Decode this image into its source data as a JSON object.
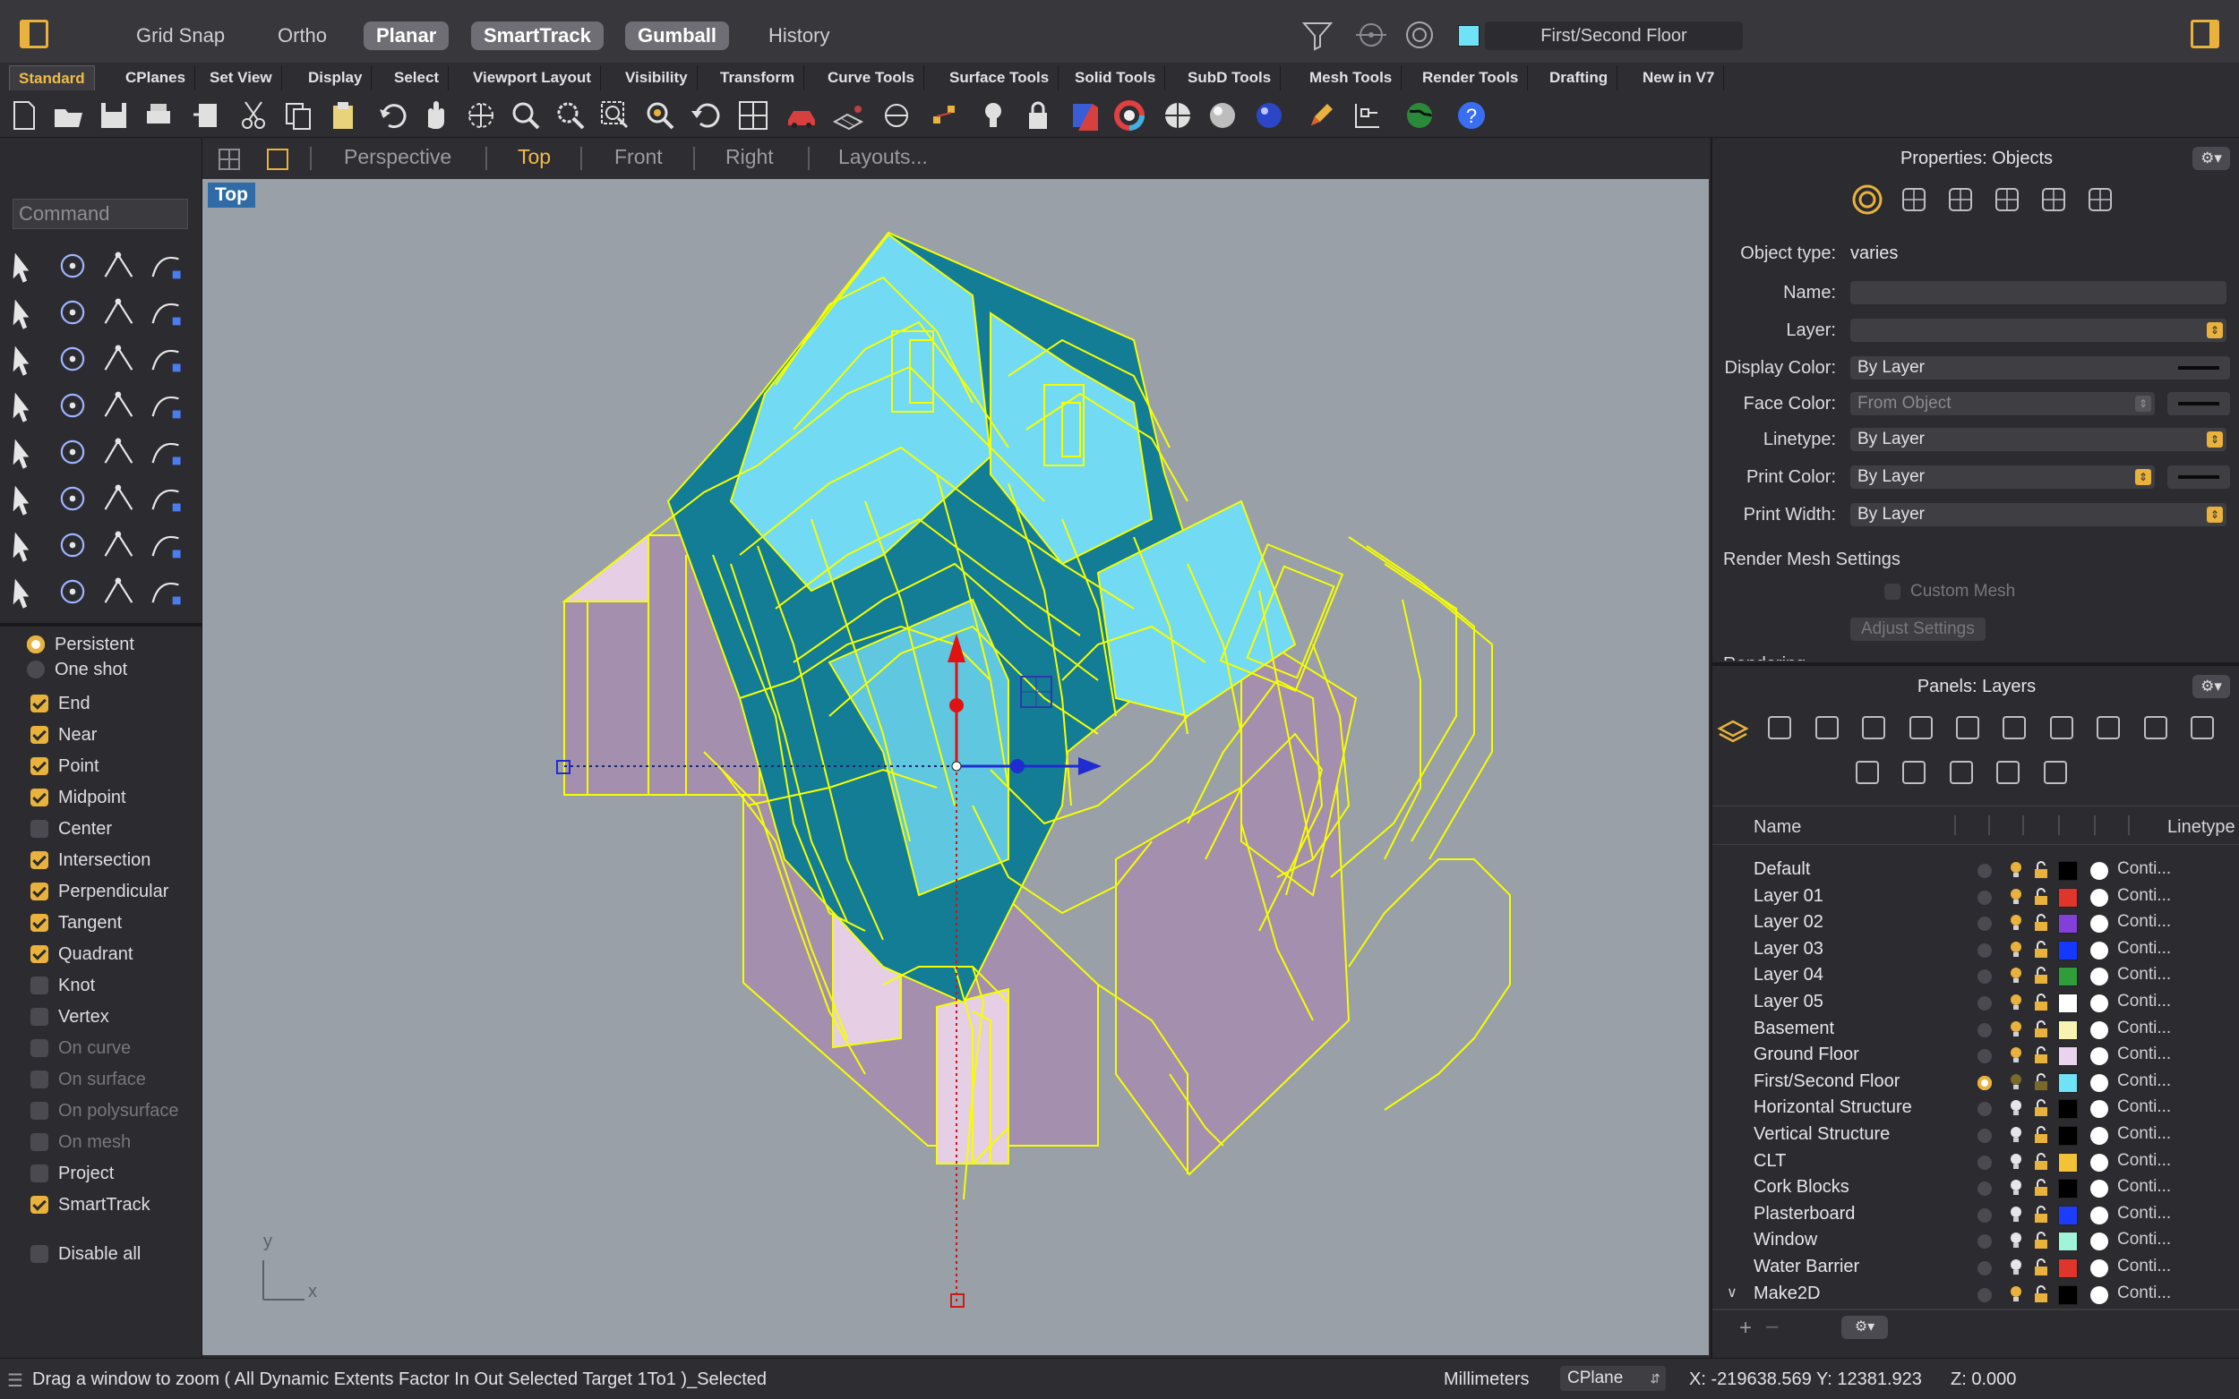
{
  "titlebar": {
    "modes": [
      "Grid Snap",
      "Ortho",
      "Planar",
      "SmartTrack",
      "Gumball",
      "History"
    ],
    "active_modes": [
      2,
      3,
      4
    ],
    "current_layer": "First/Second Floor",
    "current_layer_color": "#6fe2f7"
  },
  "ribbon_tabs": [
    "Standard",
    "CPlanes",
    "Set View",
    "Display",
    "Select",
    "Viewport Layout",
    "Visibility",
    "Transform",
    "Curve Tools",
    "Surface Tools",
    "Solid Tools",
    "SubD Tools",
    "Mesh Tools",
    "Render Tools",
    "Drafting",
    "New in V7"
  ],
  "active_tab": "Standard",
  "command": {
    "placeholder": "Command"
  },
  "osnap": {
    "persistent": "Persistent",
    "oneshot": "One shot",
    "items": [
      {
        "label": "End",
        "checked": true,
        "enabled": true
      },
      {
        "label": "Near",
        "checked": true,
        "enabled": true
      },
      {
        "label": "Point",
        "checked": true,
        "enabled": true
      },
      {
        "label": "Midpoint",
        "checked": true,
        "enabled": true
      },
      {
        "label": "Center",
        "checked": false,
        "enabled": true
      },
      {
        "label": "Intersection",
        "checked": true,
        "enabled": true
      },
      {
        "label": "Perpendicular",
        "checked": true,
        "enabled": true
      },
      {
        "label": "Tangent",
        "checked": true,
        "enabled": true
      },
      {
        "label": "Quadrant",
        "checked": true,
        "enabled": true
      },
      {
        "label": "Knot",
        "checked": false,
        "enabled": true
      },
      {
        "label": "Vertex",
        "checked": false,
        "enabled": true
      },
      {
        "label": "On curve",
        "checked": false,
        "enabled": false
      },
      {
        "label": "On surface",
        "checked": false,
        "enabled": false
      },
      {
        "label": "On polysurface",
        "checked": false,
        "enabled": false
      },
      {
        "label": "On mesh",
        "checked": false,
        "enabled": false
      },
      {
        "label": "Project",
        "checked": false,
        "enabled": true
      },
      {
        "label": "SmartTrack",
        "checked": true,
        "enabled": true
      }
    ],
    "disable_all": "Disable all"
  },
  "viewport": {
    "tabs": [
      "Perspective",
      "Top",
      "Front",
      "Right",
      "Layouts..."
    ],
    "active": "Top",
    "label": "Top",
    "axis_y": "y",
    "axis_x": "x"
  },
  "properties": {
    "title": "Properties: Objects",
    "object_type_label": "Object type:",
    "object_type_value": "varies",
    "rows": [
      {
        "label": "Name:",
        "value": ""
      },
      {
        "label": "Layer:",
        "value": ""
      },
      {
        "label": "Display Color:",
        "value": "By Layer"
      },
      {
        "label": "Face Color:",
        "value": "From Object"
      },
      {
        "label": "Linetype:",
        "value": "By Layer"
      },
      {
        "label": "Print Color:",
        "value": "By Layer"
      },
      {
        "label": "Print Width:",
        "value": "By Layer"
      }
    ],
    "render_mesh": "Render Mesh Settings",
    "custom_mesh": "Custom Mesh",
    "adjust": "Adjust Settings",
    "rendering": "Rendering"
  },
  "layers": {
    "title": "Panels: Layers",
    "col_name": "Name",
    "col_linetype": "Linetype",
    "rows": [
      {
        "name": "Default",
        "color": "#000000",
        "linetype": "Conti...",
        "current": false
      },
      {
        "name": "Layer 01",
        "color": "#e0352b",
        "linetype": "Conti...",
        "current": false
      },
      {
        "name": "Layer 02",
        "color": "#8340d9",
        "linetype": "Conti...",
        "current": false
      },
      {
        "name": "Layer 03",
        "color": "#1438ff",
        "linetype": "Conti...",
        "current": false
      },
      {
        "name": "Layer 04",
        "color": "#2f9d3a",
        "linetype": "Conti...",
        "current": false
      },
      {
        "name": "Layer 05",
        "color": "#ffffff",
        "linetype": "Conti...",
        "current": false
      },
      {
        "name": "Basement",
        "color": "#f7f3b2",
        "linetype": "Conti...",
        "current": false
      },
      {
        "name": "Ground Floor",
        "color": "#e9d3ef",
        "linetype": "Conti...",
        "current": false
      },
      {
        "name": "First/Second Floor",
        "color": "#6fe2f7",
        "linetype": "Conti...",
        "current": true
      },
      {
        "name": "Horizontal Structure",
        "color": "#000000",
        "linetype": "Conti...",
        "current": false
      },
      {
        "name": "Vertical Structure",
        "color": "#000000",
        "linetype": "Conti...",
        "current": false
      },
      {
        "name": "CLT",
        "color": "#f2c339",
        "linetype": "Conti...",
        "current": false
      },
      {
        "name": "Cork Blocks",
        "color": "#000000",
        "linetype": "Conti...",
        "current": false
      },
      {
        "name": "Plasterboard",
        "color": "#1d3cff",
        "linetype": "Conti...",
        "current": false
      },
      {
        "name": "Window",
        "color": "#9ff4d9",
        "linetype": "Conti...",
        "current": false
      },
      {
        "name": "Water Barrier",
        "color": "#e0352b",
        "linetype": "Conti...",
        "current": false
      },
      {
        "name": "Make2D",
        "color": "#000000",
        "linetype": "Conti...",
        "current": false
      }
    ]
  },
  "status": {
    "message": "Drag a window to zoom ( All Dynamic Extents Factor In Out Selected Target 1To1 )_Selected",
    "units": "Millimeters",
    "cplane": "CPlane",
    "coords": "X: -219638.569 Y: 12381.923",
    "z": "Z: 0.000"
  },
  "colors": {
    "accent": "#e8b23c",
    "viewport_bg": "#9aa0a8",
    "selection": "#f5ff00"
  }
}
